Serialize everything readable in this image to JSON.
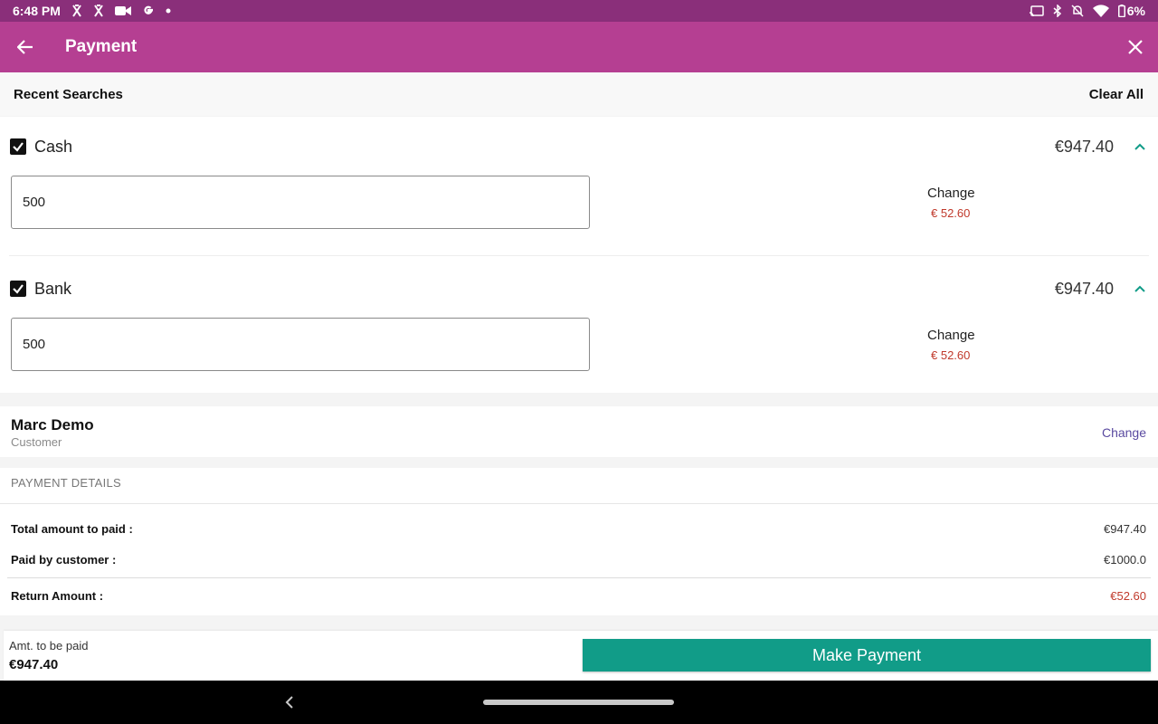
{
  "status_bar": {
    "time": "6:48 PM",
    "battery": "6%",
    "icons": [
      "x-fitness-icon",
      "x-fitness-icon",
      "video-camera-icon",
      "google-icon",
      "dot-icon",
      "cast-icon",
      "bluetooth-icon",
      "mute-bell-icon",
      "wifi-icon",
      "battery-icon"
    ]
  },
  "app_bar": {
    "title": "Payment",
    "back_icon": "arrow-left-icon",
    "close_icon": "close-icon",
    "background": "#b53f92"
  },
  "recent": {
    "title": "Recent Searches",
    "clear_label": "Clear All"
  },
  "methods": [
    {
      "name": "Cash",
      "checked": true,
      "amount": "€947.40",
      "input_value": "500",
      "change_label": "Change",
      "change_value": "€ 52.60"
    },
    {
      "name": "Bank",
      "checked": true,
      "amount": "€947.40",
      "input_value": "500",
      "change_label": "Change",
      "change_value": "€ 52.60"
    }
  ],
  "customer": {
    "name": "Marc Demo",
    "role": "Customer",
    "change_label": "Change"
  },
  "payment_details": {
    "title": "PAYMENT DETAILS",
    "rows": [
      {
        "label": "Total amount to paid :",
        "value": "€947.40"
      },
      {
        "label": "Paid by customer :",
        "value": "€1000.0"
      },
      {
        "label": "Return Amount :",
        "value": "€52.60"
      }
    ]
  },
  "bottom": {
    "amount_label": "Amt. to be paid",
    "amount_value": "€947.40",
    "pay_button": "Make Payment",
    "accent": "#119c88"
  },
  "colors": {
    "status_bar": "#8a2f7a",
    "change_red": "#c0392b",
    "link_purple": "#5a4aa0",
    "chevron_teal": "#119c88"
  }
}
